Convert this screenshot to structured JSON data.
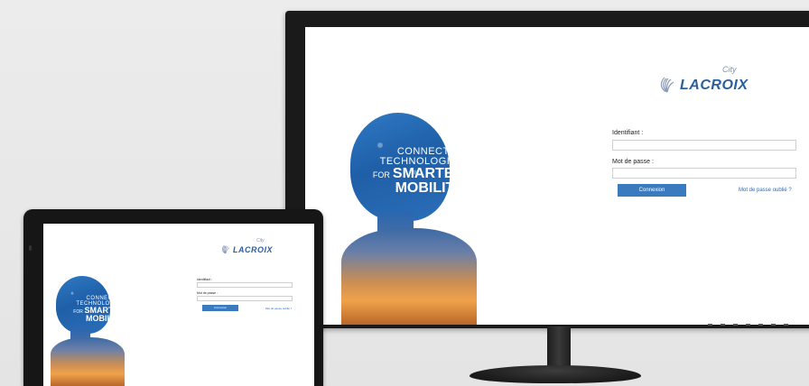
{
  "login": {
    "logo_text": "LACROIX",
    "logo_city": "City",
    "hero_line1": "CONNECTED",
    "hero_line2": "TECHNOLOGIES",
    "hero_for": "FOR",
    "hero_line3": "SMARTER",
    "hero_line4": "MOBILITY",
    "username_label": "Identifiant :",
    "username_value": "",
    "password_label": "Mot de passe :",
    "password_value": "",
    "connect_label": "Connexion",
    "forgot_label": "Mot de passe oublié ?"
  },
  "colors": {
    "brand_blue": "#2a5f9e",
    "button_blue": "#3a7bc0",
    "link_blue": "#2a6ab8"
  }
}
